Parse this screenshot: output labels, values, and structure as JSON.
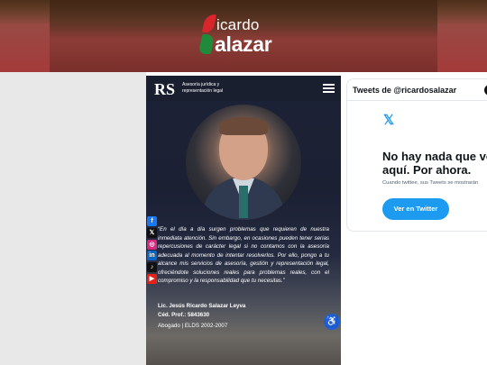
{
  "banner": {
    "logo_line1": "icardo",
    "logo_line2": "alazar",
    "logo_initial_r": "R",
    "logo_initial_s": "S"
  },
  "card": {
    "brand_mark": "RS",
    "brand_sub": "Asesoría jurídica y representación legal",
    "quote": "“En el día a día surgen problemas que requieren de nuestra inmediata atención. Sin embargo, en ocasiones pueden tener serias repercusiones de carácter legal si no contamos con la asesoría adecuada al momento de intentar resolverlos. Por ello, pongo a tu alcance mis servicios de asesoría, gestión y representación legal, ofreciéndote soluciones reales para problemas reales, con el compromiso y la responsabilidad que tu necesitas.”",
    "name": "Lic. Jesús Ricardo Salazar Leyva",
    "cedula": "Céd. Prof.: 5843630",
    "role": "Abogado | ELDS 2002-2007",
    "social_icons": [
      {
        "name": "facebook-icon",
        "glyph": "f",
        "color": "#1877f2"
      },
      {
        "name": "x-icon",
        "glyph": "𝕏",
        "color": "#111111"
      },
      {
        "name": "instagram-icon",
        "glyph": "◎",
        "color": "#d6297b"
      },
      {
        "name": "linkedin-icon",
        "glyph": "in",
        "color": "#0a66c2"
      },
      {
        "name": "tiktok-icon",
        "glyph": "♪",
        "color": "#111111"
      },
      {
        "name": "youtube-icon",
        "glyph": "▶",
        "color": "#e62117"
      }
    ],
    "accessibility_glyph": "♿"
  },
  "twitter": {
    "header": "Tweets de @ricardosalazar",
    "x_logo": "𝕏",
    "empty_title": "No hay nada que ver aquí. Por ahora.",
    "empty_note": "Cuando twittee, sus Tweets se mostrarán",
    "button": "Ver en Twitter",
    "accent": "#1d9bf0"
  }
}
